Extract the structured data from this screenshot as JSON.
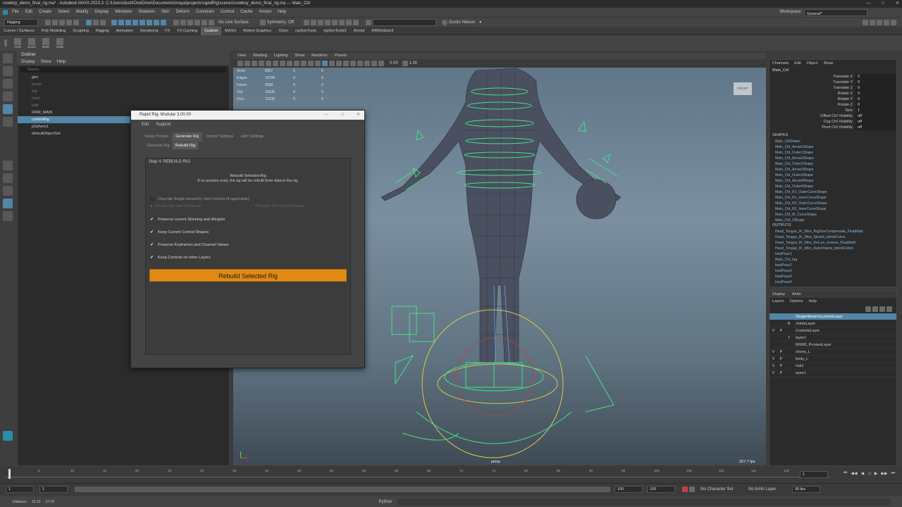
{
  "window": {
    "title": "cowboy_demo_final_rig.ma* - Autodesk MAYA 2023.3: C:\\Users\\dusti\\OneDrive\\Documents\\maya\\projects\\rapidRig\\scenes\\cowboy_demo_final_rig.ma  ---  Main_Ctrl",
    "workspace_label": "Workspace:",
    "workspace_value": "General*"
  },
  "menus": [
    "File",
    "Edit",
    "Create",
    "Select",
    "Modify",
    "Display",
    "Windows",
    "Skeleton",
    "Skin",
    "Deform",
    "Constrain",
    "Control",
    "Cache",
    "Arnold",
    "Help"
  ],
  "statusline": {
    "mode": "Rigging",
    "live_surface": "No Live Surface",
    "symmetry": "Symmetry: Off",
    "user": "Dustin Nelson"
  },
  "shelf_tabs": [
    "Curves / Surfaces",
    "Poly Modeling",
    "Sculpting",
    "Rigging",
    "Animation",
    "Rendering",
    "FX",
    "FX Caching",
    "Custom",
    "MASH",
    "Motion Graphics",
    "XGen",
    "ngSkinTools",
    "ngSkinTools2",
    "Arnold",
    "RRModular3"
  ],
  "shelf_active": "Custom",
  "shelf_items": [
    "rrm3",
    "sLock",
    "DelH",
    "node"
  ],
  "outliner": {
    "title": "Outliner",
    "menu": [
      "Display",
      "Show",
      "Help"
    ],
    "search_placeholder": "Search...",
    "items": [
      {
        "label": "geo",
        "selected": false,
        "dim": false
      },
      {
        "label": "persp",
        "selected": false,
        "dim": true
      },
      {
        "label": "top",
        "selected": false,
        "dim": true
      },
      {
        "label": "front",
        "selected": false,
        "dim": true
      },
      {
        "label": "side",
        "selected": false,
        "dim": true
      },
      {
        "label": "RRM_MAIN",
        "selected": false,
        "dim": false
      },
      {
        "label": "controlRig",
        "selected": true,
        "dim": false
      },
      {
        "label": "pSphere1",
        "selected": false,
        "dim": false
      },
      {
        "label": "defaultObjectSet",
        "selected": false,
        "dim": false
      }
    ]
  },
  "viewport": {
    "menu": [
      "View",
      "Shading",
      "Lighting",
      "Show",
      "Renderer",
      "Panels"
    ],
    "hud": [
      {
        "k": "Verts:",
        "a": "8397",
        "b": "0",
        "c": "0"
      },
      {
        "k": "Edges:",
        "a": "16758",
        "b": "0",
        "c": "0"
      },
      {
        "k": "Faces:",
        "a": "8368",
        "b": "0",
        "c": "0"
      },
      {
        "k": "Tris:",
        "a": "16636",
        "b": "0",
        "c": "0"
      },
      {
        "k": "UVs:",
        "a": "12105",
        "b": "0",
        "c": "0"
      }
    ],
    "camera": "persp",
    "fps": "257.7 fps",
    "viewcube": "FRONT",
    "exposure": "0.00",
    "gamma": "1.00"
  },
  "dialog": {
    "title": "Rapid Rig: Modular 3.00.00",
    "menu": [
      "Edit",
      "Support"
    ],
    "tabs": [
      "Setup Proxies",
      "Generate Rig",
      "Control Settings",
      "Joint Settings"
    ],
    "active_tab": "Generate Rig",
    "subtabs": [
      "Generate Rig",
      "Rebuild Rig"
    ],
    "active_subtab": "Rebuild Rig",
    "step": "Step 4: REBUILD RIG",
    "info1": "Rebuild Selected Rig",
    "info2": "If no proxies exist, the rig will be rebuilt from data in the rig.",
    "override": "Override Single Hierarchy Joint Orients (if applicable)",
    "freeze": "Freeze SH Joint Rotations",
    "preserve_sh": "Preserve SH Joint Rotations",
    "options": [
      {
        "label": "Preserve current Skinning and Weights",
        "checked": true
      },
      {
        "label": "Keep Current Control Shapes",
        "checked": true
      },
      {
        "label": "Preserve Keyframes and Channel Values",
        "checked": true
      },
      {
        "label": "Keep Controls on other Layers",
        "checked": true
      }
    ],
    "button": "Rebuild Selected Rig"
  },
  "channelbox": {
    "tabs": [
      "Channels",
      "Edit",
      "Object",
      "Show"
    ],
    "object": "Main_Ctrl",
    "channels": [
      {
        "k": "Translate X",
        "v": "0"
      },
      {
        "k": "Translate Y",
        "v": "0"
      },
      {
        "k": "Translate Z",
        "v": "0"
      },
      {
        "k": "Rotate X",
        "v": "0"
      },
      {
        "k": "Rotate Y",
        "v": "0"
      },
      {
        "k": "Rotate Z",
        "v": "0"
      },
      {
        "k": "Size",
        "v": "1"
      },
      {
        "k": "Offset Ctrl Visibility",
        "v": "off"
      },
      {
        "k": "Cog Ctrl Visibility",
        "v": "off"
      },
      {
        "k": "Pivot Ctrl Visibility",
        "v": "off"
      }
    ],
    "shapes_title": "SHAPES",
    "shapes": [
      "Main_CtrlShape",
      "Main_Ctrl_Arrow1Shape",
      "Main_Ctrl_Outer1Shape",
      "Main_Ctrl_Arrow2Shape",
      "Main_Ctrl_Outer2Shape",
      "Main_Ctrl_Arrow3Shape",
      "Main_Ctrl_Outer3Shape",
      "Main_Ctrl_Arrow4Shape",
      "Main_Ctrl_Outer4Shape",
      "Main_Ctrl_R1_OuterCurveShape",
      "Main_Ctrl_R1_InnerCurveShape",
      "Main_Ctrl_R2_OuterCurveShape",
      "Main_Ctrl_R2_InnerCurveShape",
      "Main_Ctrl_M_CurveShape",
      "Main_Ctrl_2Shape"
    ],
    "outputs_title": "OUTPUTS",
    "outputs": [
      "Head_Tongue_IK_Wire_RigSizeCompensate_FloatMath",
      "Head_Tongue_IK_Wire_Stretch_blendColors",
      "Head_Tongue_IK_Wire_ArcLen_Inverse_FloatMath",
      "Head_Tongue_IK_Wire_AutoVolume_blendColors",
      "bindPose1",
      "Main_Ctrl_tag",
      "bindPose2",
      "bindPose3",
      "bindPose4",
      "bindPose5"
    ]
  },
  "layers": {
    "tabs": [
      "Display",
      "Anim"
    ],
    "menu": [
      "Layers",
      "Options",
      "Help"
    ],
    "items": [
      {
        "v": "",
        "p": "",
        "t": "",
        "name": "SingleHierarchyJointsLayer",
        "selected": true
      },
      {
        "v": "",
        "p": "",
        "t": "R",
        "name": "JointsLayer",
        "selected": false
      },
      {
        "v": "V",
        "p": "P",
        "t": "",
        "name": "ControlsLayer",
        "selected": false
      },
      {
        "v": "",
        "p": "",
        "t": "T",
        "name": "layer1",
        "selected": false
      },
      {
        "v": "",
        "p": "",
        "t": "",
        "name": "RRM3_ProxiesLayer",
        "selected": false
      },
      {
        "v": "V",
        "p": "P",
        "t": "",
        "name": "shoes_L",
        "selected": false
      },
      {
        "v": "V",
        "p": "P",
        "t": "",
        "name": "body_L",
        "selected": false
      },
      {
        "v": "V",
        "p": "P",
        "t": "",
        "name": "Hat1",
        "selected": false
      },
      {
        "v": "V",
        "p": "P",
        "t": "",
        "name": "eyes1",
        "selected": false
      }
    ]
  },
  "timeline": {
    "ticks": [
      "5",
      "10",
      "15",
      "20",
      "25",
      "30",
      "35",
      "40",
      "45",
      "50",
      "55",
      "60",
      "65",
      "70",
      "75",
      "80",
      "85",
      "90",
      "95",
      "100",
      "105",
      "110",
      "115",
      "120"
    ],
    "current": "1"
  },
  "range": {
    "start": "1",
    "start2": "1",
    "end": "100",
    "end2": "100",
    "char_set": "No Character Set",
    "anim_layer": "No Anim Layer",
    "fps": "30 fps"
  },
  "cmdline": {
    "left": "Distance:",
    "val1": "15.10",
    "val2": "-17.07",
    "lang": "Python"
  }
}
